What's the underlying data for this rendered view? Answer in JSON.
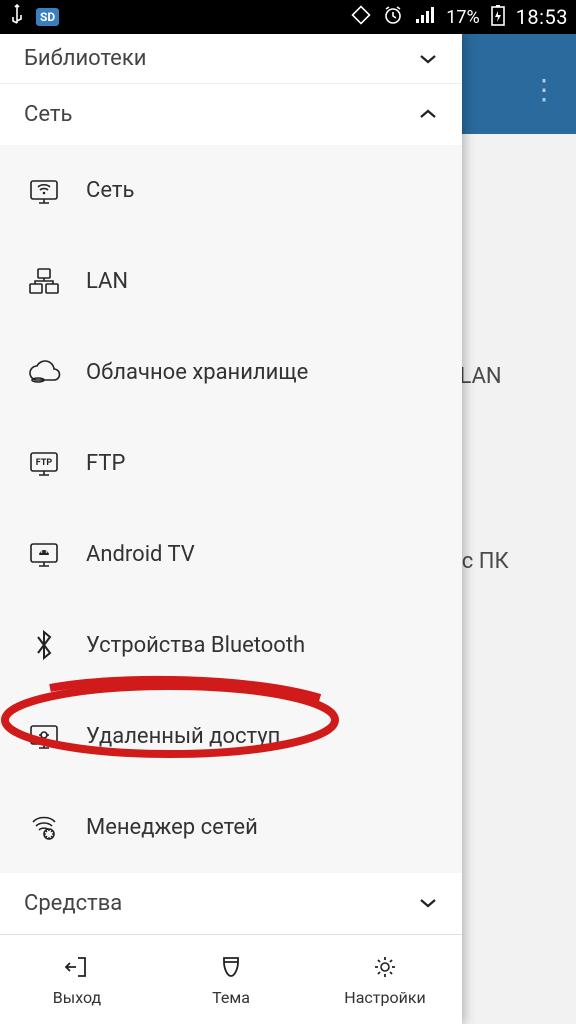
{
  "status_bar": {
    "battery_pct": "17%",
    "clock": "18:53",
    "sd_label": "SD"
  },
  "background": {
    "wlan_text": "WLAN",
    "pc_text": "м с ПК"
  },
  "sections": {
    "libraries": {
      "title": "Библиотеки",
      "expanded": false
    },
    "network": {
      "title": "Сеть",
      "expanded": true
    },
    "tools": {
      "title": "Средства",
      "expanded": false
    }
  },
  "network_items": [
    {
      "id": "network",
      "label": "Сеть"
    },
    {
      "id": "lan",
      "label": "LAN"
    },
    {
      "id": "cloud",
      "label": "Облачное хранилище"
    },
    {
      "id": "ftp",
      "label": "FTP"
    },
    {
      "id": "androidtv",
      "label": "Android TV"
    },
    {
      "id": "bluetooth",
      "label": "Устройства Bluetooth"
    },
    {
      "id": "remote",
      "label": "Удаленный доступ",
      "highlighted": true
    },
    {
      "id": "netmgr",
      "label": "Менеджер сетей"
    }
  ],
  "bottom_bar": {
    "exit": "Выход",
    "theme": "Тема",
    "settings": "Настройки"
  }
}
